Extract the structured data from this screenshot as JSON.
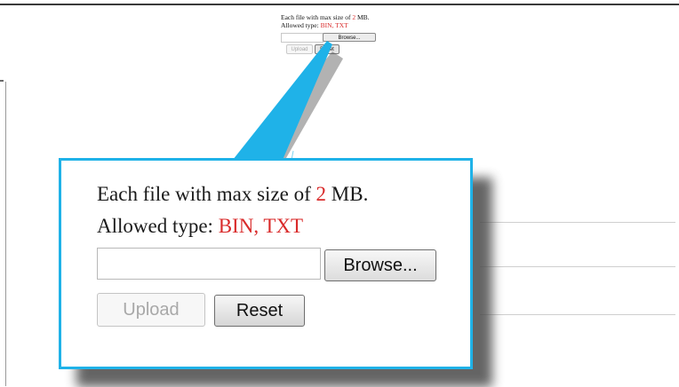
{
  "upload_form": {
    "size_prefix": "Each file with max size of ",
    "size_value": "2",
    "size_suffix": " MB.",
    "type_prefix": "Allowed type: ",
    "type_value": "BIN, TXT",
    "file_value": "",
    "browse_label": "Browse...",
    "upload_label": "Upload",
    "reset_label": "Reset"
  },
  "colors": {
    "accent": "#1fb2e8",
    "highlight_text": "#d92b2b"
  }
}
